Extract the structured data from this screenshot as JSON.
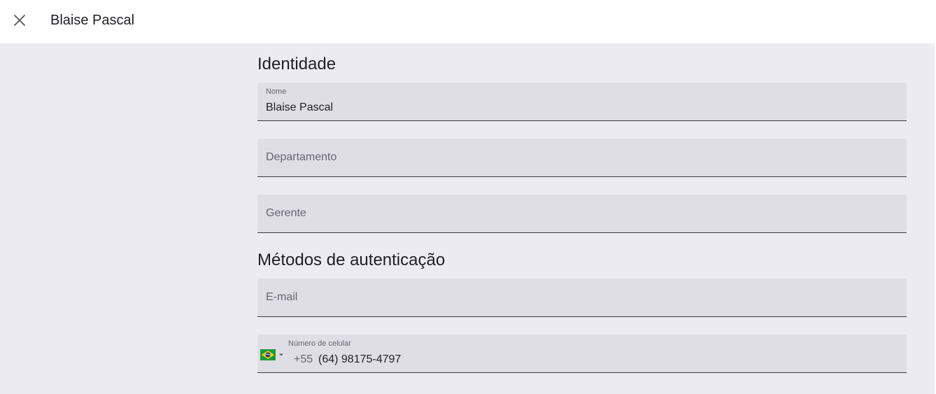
{
  "header": {
    "title": "Blaise Pascal",
    "close_icon": "close-icon"
  },
  "identity": {
    "section_title": "Identidade",
    "name_field": {
      "label": "Nome",
      "value": "Blaise Pascal"
    },
    "department_field": {
      "placeholder": "Departamento"
    },
    "manager_field": {
      "placeholder": "Gerente"
    }
  },
  "auth_methods": {
    "section_title": "Métodos de autenticação",
    "email_field": {
      "placeholder": "E-mail"
    },
    "phone_field": {
      "label": "Número de celular",
      "country_flag": "brazil-flag-icon",
      "country_code": "+55",
      "value": "(64) 98175-4797"
    }
  },
  "colors": {
    "page_background": "#ecebf1",
    "header_background": "#ffffff",
    "field_background": "#dfdee4",
    "text_primary": "#1f1f24",
    "text_secondary": "#66656d"
  }
}
